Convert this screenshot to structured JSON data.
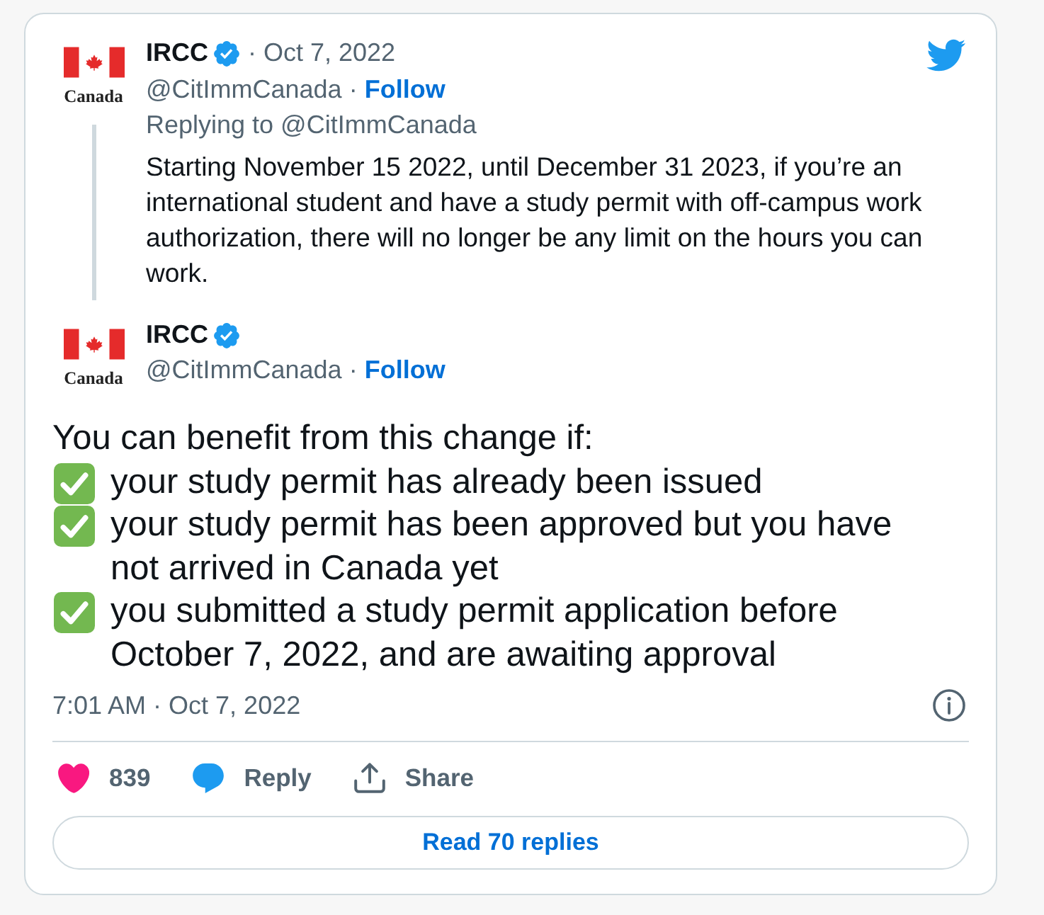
{
  "quoted_tweet": {
    "avatar_wordmark": "Canada",
    "name": "IRCC",
    "verified": true,
    "date_separator": "·",
    "date": "Oct 7, 2022",
    "handle": "@CitImmCanada",
    "follow_separator": "·",
    "follow": "Follow",
    "replying_to": "Replying to @CitImmCanada",
    "text": "Starting November 15 2022, until December 31 2023, if you’re an international student and have a study permit with off-campus work authorization, there will no longer be any limit on the hours you can work."
  },
  "tweet": {
    "avatar_wordmark": "Canada",
    "name": "IRCC",
    "verified": true,
    "handle": "@CitImmCanada",
    "follow_separator": "·",
    "follow": "Follow",
    "intro": "You can benefit from this change if:",
    "points": [
      "your study permit has already been issued",
      "your study permit has been approved but you have not arrived in Canada yet",
      "you submitted a study permit application before October 7, 2022, and are awaiting approval"
    ],
    "timestamp": "7:01 AM · Oct 7, 2022"
  },
  "actions": [
    {
      "kind": "like",
      "label": "839"
    },
    {
      "kind": "reply",
      "label": "Reply"
    },
    {
      "kind": "share",
      "label": "Share"
    }
  ],
  "read_replies": "Read 70 replies"
}
